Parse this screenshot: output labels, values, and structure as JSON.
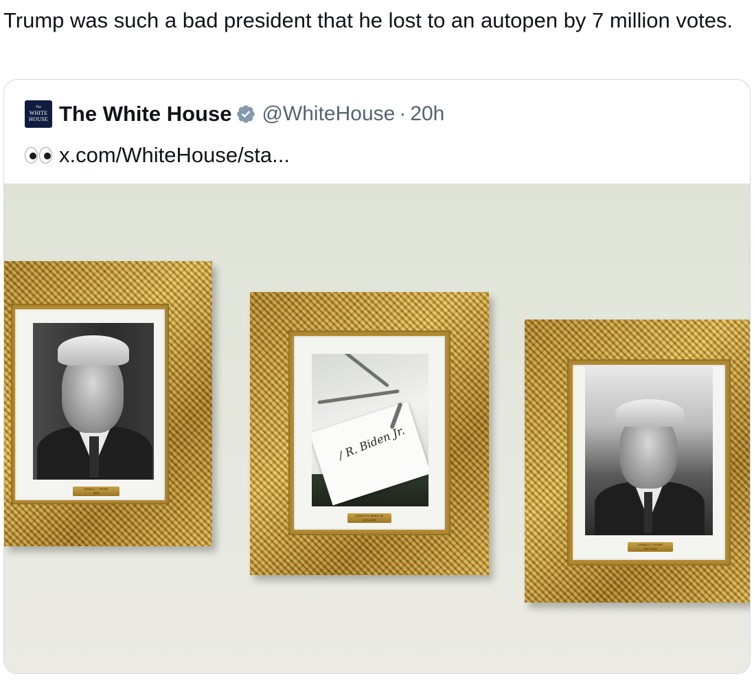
{
  "post": {
    "text": "Trump was such a bad president that he lost to an autopen by 7 million votes."
  },
  "quoted": {
    "avatar_text_small": "The",
    "avatar_text_line1": "WHITE",
    "avatar_text_line2": "HOUSE",
    "author_name": "The White House",
    "handle": "@WhiteHouse",
    "separator": "·",
    "time": "20h",
    "link_text": "x.com/WhiteHouse/sta...",
    "emoji_icon": "eyes-emoji",
    "verified_color": "#829aab"
  },
  "photo": {
    "plaques": [
      {
        "line1": "DONALD J. TRUMP",
        "line2": "2025"
      },
      {
        "line1": "JOSEPH R. BIDEN JR.",
        "line2": "2021-2025"
      },
      {
        "line1": "DONALD J. TRUMP",
        "line2": "2017-2021"
      }
    ]
  }
}
